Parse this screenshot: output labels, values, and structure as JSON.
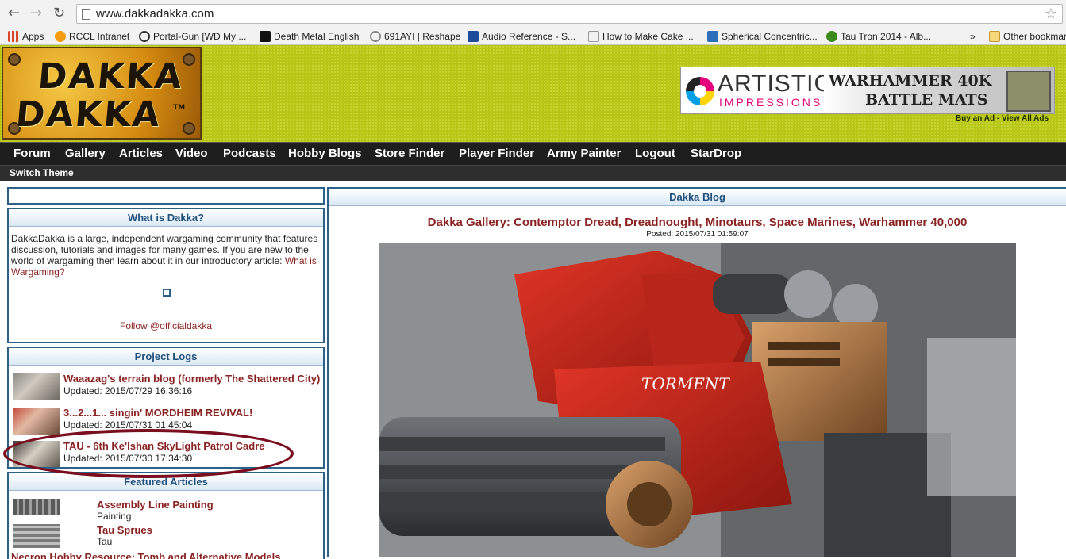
{
  "browser": {
    "url": "www.dakkadakka.com",
    "bookmarks": [
      {
        "label": "Apps",
        "color": "#d9472b"
      },
      {
        "label": "RCCL Intranet",
        "color": "#f39c12"
      },
      {
        "label": "Portal-Gun [WD My ...",
        "color": "#333333"
      },
      {
        "label": "Death Metal English",
        "color": "#111111"
      },
      {
        "label": "691AYI | Reshape",
        "color": "#888888"
      },
      {
        "label": "Audio Reference - S...",
        "color": "#1f4b99"
      },
      {
        "label": "How to Make Cake ...",
        "color": "#bbbbbb"
      },
      {
        "label": "Spherical Concentric...",
        "color": "#2a6fb7"
      },
      {
        "label": "Tau Tron 2014 - Alb...",
        "color": "#3c8a1e"
      }
    ],
    "overflow": "»",
    "other_bookmarks": "Other bookmarks"
  },
  "header": {
    "logo_word1": "DAKKA",
    "logo_word2": "DAKKA",
    "logo_tm": "TM",
    "ad": {
      "brand_line1": "ARTISTIC",
      "brand_line2": "IMPRESSIONS",
      "title_line1": "WARHAMMER 40K",
      "title_line2": "BATTLE MATS"
    },
    "ad_links": "Buy an Ad - View All Ads"
  },
  "nav": {
    "items": [
      "Forum",
      "Gallery",
      "Articles",
      "Video",
      "Podcasts",
      "Hobby Blogs",
      "Store Finder",
      "Player Finder",
      "Army Painter",
      "Logout",
      "StarDrop"
    ],
    "switch_theme": "Switch Theme"
  },
  "what_is_dakka": {
    "heading": "What is Dakka?",
    "text": "DakkaDakka is a large, independent wargaming community that features discussion, tutorials and images for many games. If you are new to the world of wargaming then learn about it in our introductory article: ",
    "link": "What is Wargaming?",
    "follow": "Follow @officialdakka"
  },
  "project_logs": {
    "heading": "Project Logs",
    "items": [
      {
        "title": "Waaazag's terrain blog (formerly The Shattered City)",
        "updated": "Updated: 2015/07/29 16:36:16"
      },
      {
        "title": "3...2...1... singin' MORDHEIM REVIVAL!",
        "updated": "Updated: 2015/07/31 01:45:04"
      },
      {
        "title": "TAU - 6th Ke'lshan SkyLight Patrol Cadre",
        "updated": "Updated: 2015/07/30 17:34:30"
      }
    ]
  },
  "featured_articles": {
    "heading": "Featured Articles",
    "items": [
      {
        "title": "Assembly Line Painting",
        "category": "Painting"
      },
      {
        "title": "Tau Sprues",
        "category": "Tau"
      }
    ],
    "cut_off_title": "Necron Hobby Resource: Tomb and Alternative Models"
  },
  "blog": {
    "heading": "Dakka Blog",
    "post_title": "Dakka Gallery: Contemptor Dread, Dreadnought, Minotaurs, Space Marines, Warhammer 40,000",
    "posted": "Posted: 2015/07/31 01:59:07",
    "hull_text": "TORMENT"
  }
}
